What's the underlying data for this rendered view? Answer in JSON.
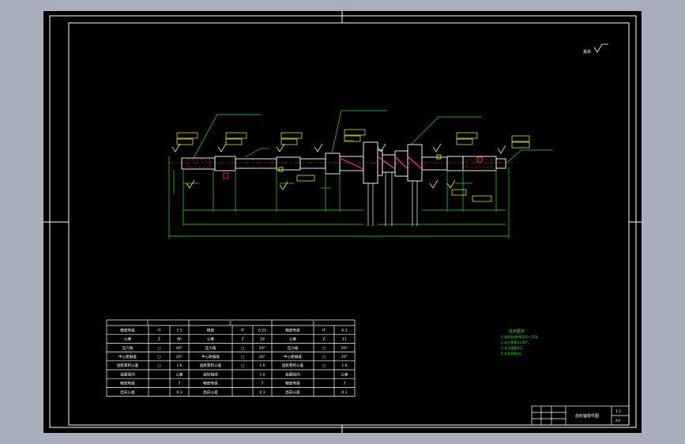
{
  "colors": {
    "window_bg": "#a9afba",
    "sheet_bg": "#000000",
    "frame": "#ffffff",
    "geometry": "#ffffff",
    "dimension": "#22e622",
    "annotation": "#ffff00",
    "hatch_accent": "#ff2d9b",
    "section_marker": "#ff3030",
    "centerline": "#ff3030",
    "tech_notes": "#22e622"
  },
  "drawing": {
    "top_right_roughness_text": "其余"
  },
  "parameter_table": {
    "group_headers": [
      "1",
      "2",
      "3"
    ],
    "rows": [
      [
        "精度等级",
        "IT",
        "2.5",
        "精度",
        "IT",
        "0.25",
        "精度等级",
        "IT",
        "6.3"
      ],
      [
        "公差",
        "Z",
        "8h",
        "公差",
        "Z",
        "18",
        "公差",
        "Z",
        "11"
      ],
      [
        "压力角",
        "□",
        "40°",
        "压力角",
        "□",
        "20°",
        "压力角",
        "□",
        "20°"
      ],
      [
        "中心距偏差",
        "□",
        "20°",
        "中心距偏差",
        "□",
        "20°",
        "中心距偏差",
        "□",
        "20°"
      ],
      [
        "齿距累积公差",
        "□",
        "1.6",
        "齿距累积公差",
        "□",
        "1.6",
        "齿距累积公差",
        "□",
        "1.6"
      ],
      [
        "齿圈径向",
        "",
        "公差",
        "齿轮轴线",
        "",
        "1.6",
        "齿圈径向",
        "",
        "公差"
      ],
      [
        "精度等级",
        "",
        "7",
        "精度等级",
        "",
        "7",
        "精度等级",
        "",
        "7"
      ],
      [
        "齿向公差",
        "",
        "0.3",
        "齿向公差",
        "",
        "0.3",
        "齿向公差",
        "",
        "0.1"
      ]
    ]
  },
  "tech_requirements": {
    "title": "技术要求",
    "items": [
      "1.调质处理HB220~250。",
      "2.未注倒角1×45°。",
      "3.未注圆角R1。",
      "4.去毛刺锐边。"
    ]
  },
  "title_block": {
    "drawing_name": "齿轮轴零件图",
    "scale": "1:1",
    "sheet": "A3"
  }
}
